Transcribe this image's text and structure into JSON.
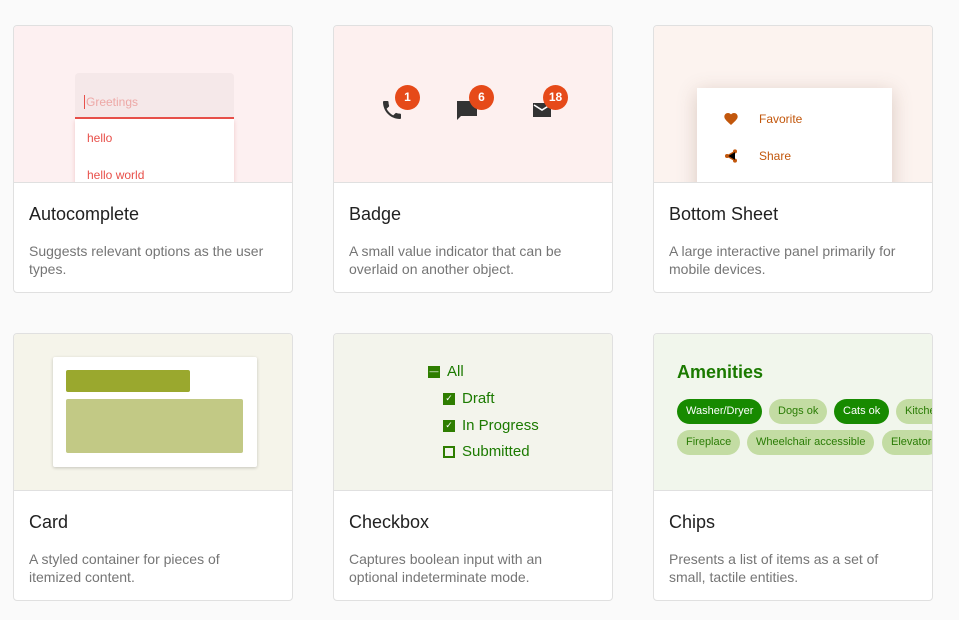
{
  "cards": [
    {
      "title": "Autocomplete",
      "description": "Suggests relevant options as the user types.",
      "preview": {
        "placeholder": "Greetings",
        "options": [
          "hello",
          "hello world"
        ]
      }
    },
    {
      "title": "Badge",
      "description": "A small value indicator that can be overlaid on another object.",
      "preview": {
        "badges": [
          {
            "icon": "phone-icon",
            "count": "1"
          },
          {
            "icon": "chat-icon",
            "count": "6"
          },
          {
            "icon": "mail-icon",
            "count": "18"
          }
        ]
      }
    },
    {
      "title": "Bottom Sheet",
      "description": "A large interactive panel primarily for mobile devices.",
      "preview": {
        "items": [
          {
            "icon": "heart-icon",
            "label": "Favorite"
          },
          {
            "icon": "share-icon",
            "label": "Share"
          }
        ]
      }
    },
    {
      "title": "Card",
      "description": "A styled container for pieces of itemized content."
    },
    {
      "title": "Checkbox",
      "description": "Captures boolean input with an optional indeterminate mode.",
      "preview": {
        "items": [
          {
            "label": "All",
            "state": "indeterminate"
          },
          {
            "label": "Draft",
            "state": "checked"
          },
          {
            "label": "In Progress",
            "state": "checked"
          },
          {
            "label": "Submitted",
            "state": "unchecked"
          }
        ]
      }
    },
    {
      "title": "Chips",
      "description": "Presents a list of items as a set of small, tactile entities.",
      "preview": {
        "heading": "Amenities",
        "chips": [
          {
            "label": "Washer/Dryer",
            "selected": true
          },
          {
            "label": "Dogs ok",
            "selected": false
          },
          {
            "label": "Cats ok",
            "selected": true
          },
          {
            "label": "Kitchen",
            "selected": false
          },
          {
            "label": "Fireplace",
            "selected": false
          },
          {
            "label": "Wheelchair accessible",
            "selected": false
          },
          {
            "label": "Elevator",
            "selected": false
          }
        ]
      }
    }
  ],
  "colors": {
    "badge": "#e64a19",
    "autocomplete_accent": "#e8504a",
    "sheet_accent": "#c2570c",
    "green": "#1b7a00",
    "card_dark": "#9aa82e",
    "card_light": "#c2c985"
  }
}
